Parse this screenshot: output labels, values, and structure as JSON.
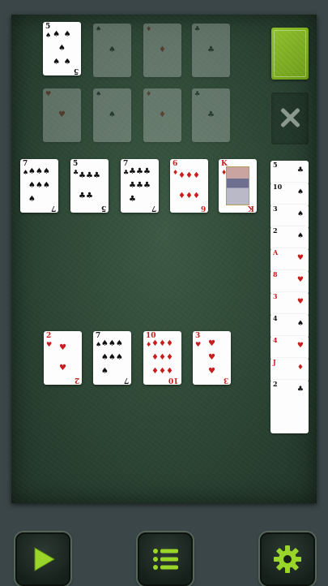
{
  "game": {
    "table_color": "#2b4433",
    "accent_color": "#8ec02a",
    "foundation_ghosts": [
      {
        "rank": "5",
        "suit": "♠",
        "color": "black"
      },
      {
        "rank": "",
        "suit": "♠",
        "color": "black"
      },
      {
        "rank": "",
        "suit": "♦",
        "color": "red"
      },
      {
        "rank": "",
        "suit": "♣",
        "color": "black"
      },
      {
        "rank": "",
        "suit": "♥",
        "color": "red"
      },
      {
        "rank": "",
        "suit": "♠",
        "color": "black"
      },
      {
        "rank": "",
        "suit": "♦",
        "color": "red"
      },
      {
        "rank": "",
        "suit": "♣",
        "color": "black"
      }
    ],
    "top_card": {
      "rank": "5",
      "suit": "♠",
      "color": "black"
    },
    "row1": [
      {
        "rank": "7",
        "suit": "♠",
        "color": "black"
      },
      {
        "rank": "5",
        "suit": "♣",
        "color": "black"
      },
      {
        "rank": "7",
        "suit": "♣",
        "color": "black"
      },
      {
        "rank": "6",
        "suit": "♦",
        "color": "red"
      },
      {
        "rank": "K",
        "suit": "♦",
        "color": "red"
      }
    ],
    "row2": [
      {
        "rank": "2",
        "suit": "♥",
        "color": "red"
      },
      {
        "rank": "7",
        "suit": "♠",
        "color": "black"
      },
      {
        "rank": "10",
        "suit": "♦",
        "color": "red"
      },
      {
        "rank": "3",
        "suit": "♥",
        "color": "red"
      }
    ],
    "side_column": [
      {
        "rank": "5",
        "suit": "♣",
        "color": "black"
      },
      {
        "rank": "10",
        "suit": "♠",
        "color": "black"
      },
      {
        "rank": "3",
        "suit": "♠",
        "color": "black"
      },
      {
        "rank": "2",
        "suit": "♠",
        "color": "black"
      },
      {
        "rank": "A",
        "suit": "♥",
        "color": "red"
      },
      {
        "rank": "8",
        "suit": "♥",
        "color": "red"
      },
      {
        "rank": "3",
        "suit": "♥",
        "color": "red"
      },
      {
        "rank": "4",
        "suit": "♠",
        "color": "black"
      },
      {
        "rank": "4",
        "suit": "♥",
        "color": "red"
      },
      {
        "rank": "J",
        "suit": "♦",
        "color": "red"
      },
      {
        "rank": "2",
        "suit": "♣",
        "color": "black"
      }
    ],
    "buttons": [
      {
        "icon": "play-icon"
      },
      {
        "icon": "menu-list-icon"
      },
      {
        "icon": "gear-icon"
      }
    ]
  }
}
